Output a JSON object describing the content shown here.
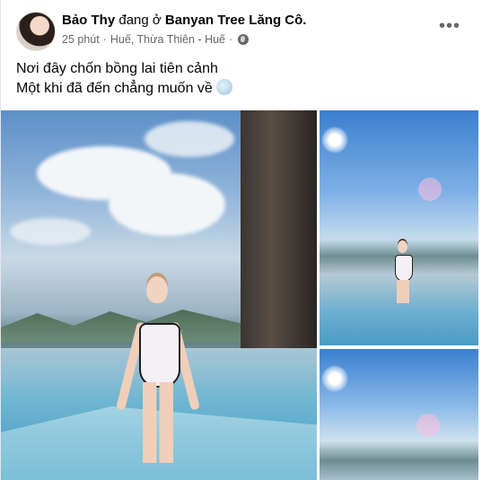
{
  "post": {
    "author": "Bảo Thy",
    "checkin_verb": "đang ở",
    "location": "Banyan Tree Lăng Cô.",
    "time": "25 phút",
    "separator": "·",
    "place": "Huế, Thừa Thiên - Huế",
    "privacy_icon": "globe-icon",
    "more_icon": "more-options-icon",
    "more_label": "•••",
    "lines": [
      "Nơi đây chốn bồng lai tiên cảnh",
      "Một khi đã đến chẳng muốn về"
    ],
    "emoji_icon": "wave-emoji-icon"
  },
  "colors": {
    "text": "#050505",
    "secondary": "#65676b",
    "sky": "#5d8fc7",
    "pool": "#3e9ac1"
  }
}
